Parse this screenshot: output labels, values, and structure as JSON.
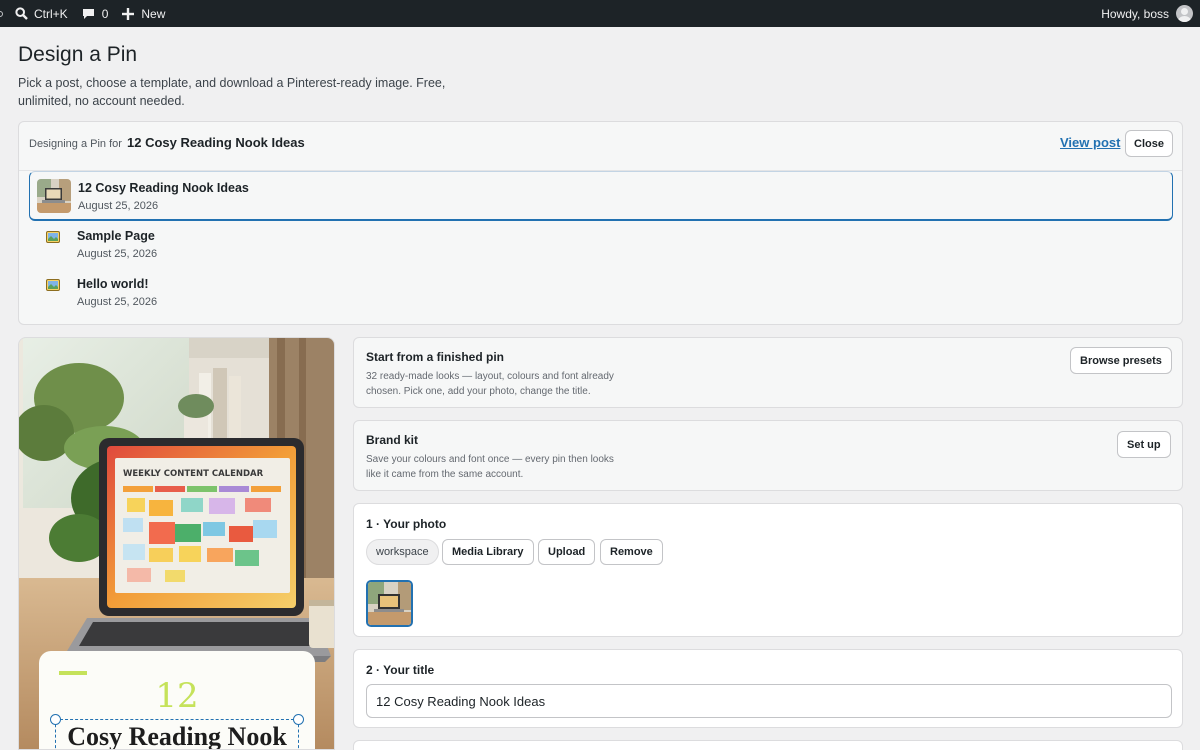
{
  "admin_bar": {
    "search_shortcut": "Ctrl+K",
    "comments_count": "0",
    "new_label": "New",
    "greeting": "Howdy, boss"
  },
  "page": {
    "title": "Design a Pin",
    "description": "Pick a post, choose a template, and download a Pinterest-ready image. Free, unlimited, no account needed."
  },
  "selector": {
    "prefix": "Designing a Pin for",
    "current_post": "12 Cosy Reading Nook Ideas",
    "view_post_label": "View post",
    "close_label": "Close",
    "posts": [
      {
        "title": "12 Cosy Reading Nook Ideas",
        "date": "August 25, 2026",
        "selected": true
      },
      {
        "title": "Sample Page",
        "date": "August 25, 2026",
        "icon": "image-placeholder-icon"
      },
      {
        "title": "Hello world!",
        "date": "August 25, 2026",
        "icon": "image-placeholder-icon"
      }
    ]
  },
  "preview": {
    "photo_caption": "WEEKLY CONTENT CALENDAR",
    "pin_number": "12",
    "pin_title": "Cosy Reading Nook",
    "accent_color": "#c5e25a"
  },
  "panels": {
    "presets": {
      "title": "Start from a finished pin",
      "description": "32 ready-made looks — layout, colours and font already chosen. Pick one, add your photo, change the title.",
      "button": "Browse presets"
    },
    "brand_kit": {
      "title": "Brand kit",
      "description": "Save your colours and font once — every pin then looks like it came from the same account.",
      "button": "Set up"
    },
    "photo": {
      "title": "1 · Your photo",
      "keyword_chip": "workspace",
      "media_library": "Media Library",
      "upload": "Upload",
      "remove": "Remove"
    },
    "title_step": {
      "title": "2 · Your title",
      "value": "12 Cosy Reading Nook Ideas"
    }
  },
  "colors": {
    "admin_bar": "#1d2327",
    "link": "#2271b1",
    "background": "#f0f0f1"
  }
}
